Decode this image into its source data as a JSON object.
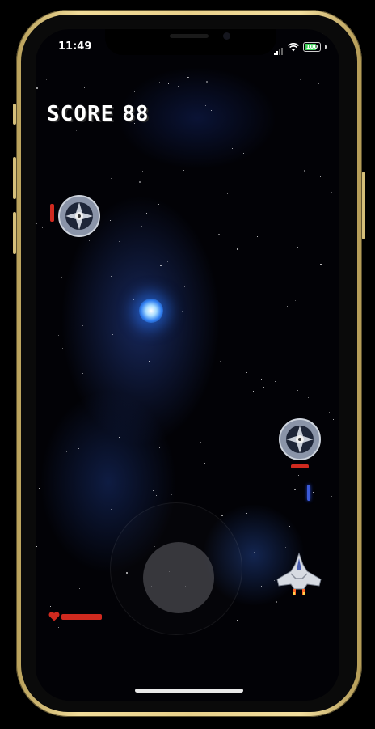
{
  "status_bar": {
    "time": "11:49",
    "battery": "100"
  },
  "hud": {
    "score_label": "SCORE",
    "score_value": "88"
  },
  "colors": {
    "frame_gold": "#e9d18c",
    "health_red": "#d02a1f",
    "laser_blue": "#3b5ad8",
    "orb_blue": "#2f7df0"
  },
  "game": {
    "player_health": 1.0,
    "enemies": [
      {
        "name": "top-left-enemy",
        "health": 1.0
      },
      {
        "name": "right-enemy",
        "health": 1.0
      }
    ]
  },
  "icons": [
    "signal-icon",
    "wifi-icon",
    "battery-icon",
    "heart-icon",
    "player-ship-icon",
    "enemy-saucer-icon"
  ]
}
